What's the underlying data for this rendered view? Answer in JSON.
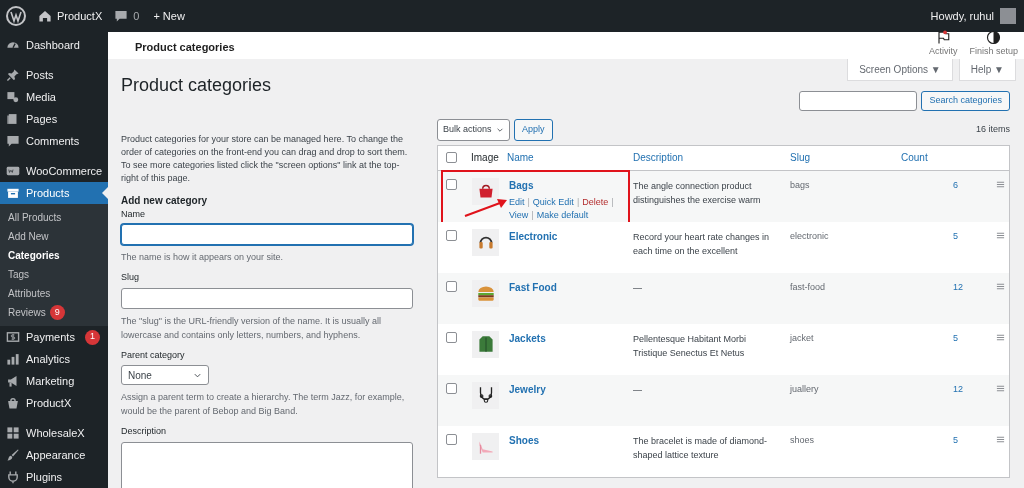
{
  "admin_bar": {
    "site": "ProductX",
    "comments": "0",
    "new": "+ New",
    "greeting": "Howdy, ruhul"
  },
  "sidebar": {
    "items": [
      {
        "label": "Dashboard",
        "selected": false
      },
      {
        "label": "Posts",
        "selected": false
      },
      {
        "label": "Media",
        "selected": false
      },
      {
        "label": "Pages",
        "selected": false
      },
      {
        "label": "Comments",
        "selected": false
      },
      {
        "label": "WooCommerce",
        "selected": false
      },
      {
        "label": "Products",
        "selected": true,
        "children": [
          {
            "label": "All Products",
            "selected": false
          },
          {
            "label": "Add New",
            "selected": false
          },
          {
            "label": "Categories",
            "selected": true
          },
          {
            "label": "Tags",
            "selected": false
          },
          {
            "label": "Attributes",
            "selected": false
          },
          {
            "label": "Reviews",
            "badge": "9",
            "selected": false
          }
        ]
      },
      {
        "label": "Payments",
        "badge": "1",
        "selected": false
      },
      {
        "label": "Analytics",
        "selected": false
      },
      {
        "label": "Marketing",
        "selected": false
      },
      {
        "label": "ProductX",
        "selected": false
      },
      {
        "label": "WholesaleX",
        "selected": false
      },
      {
        "label": "Appearance",
        "selected": false
      },
      {
        "label": "Plugins",
        "selected": false
      }
    ]
  },
  "header": {
    "title": "Product categories",
    "actions": [
      {
        "label": "Activity"
      },
      {
        "label": "Finish setup"
      }
    ]
  },
  "screen_tabs": [
    "Screen Options ▼",
    "Help ▼"
  ],
  "page_title": "Product categories",
  "intro": "Product categories for your store can be managed here. To change the order of categories on the front-end you can drag and drop to sort them. To see more categories listed click the \"screen options\" link at the top-right of this page.",
  "form": {
    "heading": "Add new category",
    "fields": [
      {
        "kind": "text",
        "label": "Name",
        "help": "The name is how it appears on your site.",
        "focused": true
      },
      {
        "kind": "text",
        "label": "Slug",
        "help": "The \"slug\" is the URL-friendly version of the name. It is usually all lowercase and contains only letters, numbers, and hyphens.",
        "focused": false
      },
      {
        "kind": "select",
        "label": "Parent category",
        "value": "None",
        "help": "Assign a parent term to create a hierarchy. The term Jazz, for example, would be the parent of Bebop and Big Band."
      },
      {
        "kind": "textarea",
        "label": "Description"
      }
    ]
  },
  "search": {
    "button": "Search categories"
  },
  "bulk": {
    "select": "Bulk actions",
    "apply": "Apply",
    "count": "16 items"
  },
  "table": {
    "select_all_checked": false,
    "columns": [
      "Image",
      "Name",
      "Description",
      "Slug",
      "Count"
    ],
    "rows": [
      {
        "name": "Bags",
        "description": "The angle connection product distinguishes the exercise warm",
        "slug": "bags",
        "count": "6",
        "checked": false,
        "highlighted": true,
        "actions": [
          {
            "label": "Edit",
            "kind": "link",
            "separator": "|"
          },
          {
            "label": "Quick Edit",
            "kind": "link",
            "separator": "|"
          },
          {
            "label": "Delete",
            "kind": "danger",
            "separator": "|"
          },
          {
            "label": "View",
            "kind": "link",
            "separator": "|"
          },
          {
            "label": "Make default",
            "kind": "link"
          }
        ]
      },
      {
        "name": "Electronic",
        "description": "Record your heart rate changes in each time on the excellent",
        "slug": "electronic",
        "count": "5",
        "checked": false,
        "highlighted": false
      },
      {
        "name": "Fast Food",
        "description": "—",
        "slug": "fast-food",
        "count": "12",
        "checked": false,
        "highlighted": false
      },
      {
        "name": "Jackets",
        "description": "Pellentesque Habitant Morbi Tristique Senectus Et Netus",
        "slug": "jacket",
        "count": "5",
        "checked": false,
        "highlighted": false
      },
      {
        "name": "Jewelry",
        "description": "—",
        "slug": "juallery",
        "count": "12",
        "checked": false,
        "highlighted": false
      },
      {
        "name": "Shoes",
        "description": "The bracelet is made of diamond-shaped lattice texture",
        "slug": "shoes",
        "count": "5",
        "checked": false,
        "highlighted": false
      }
    ]
  }
}
